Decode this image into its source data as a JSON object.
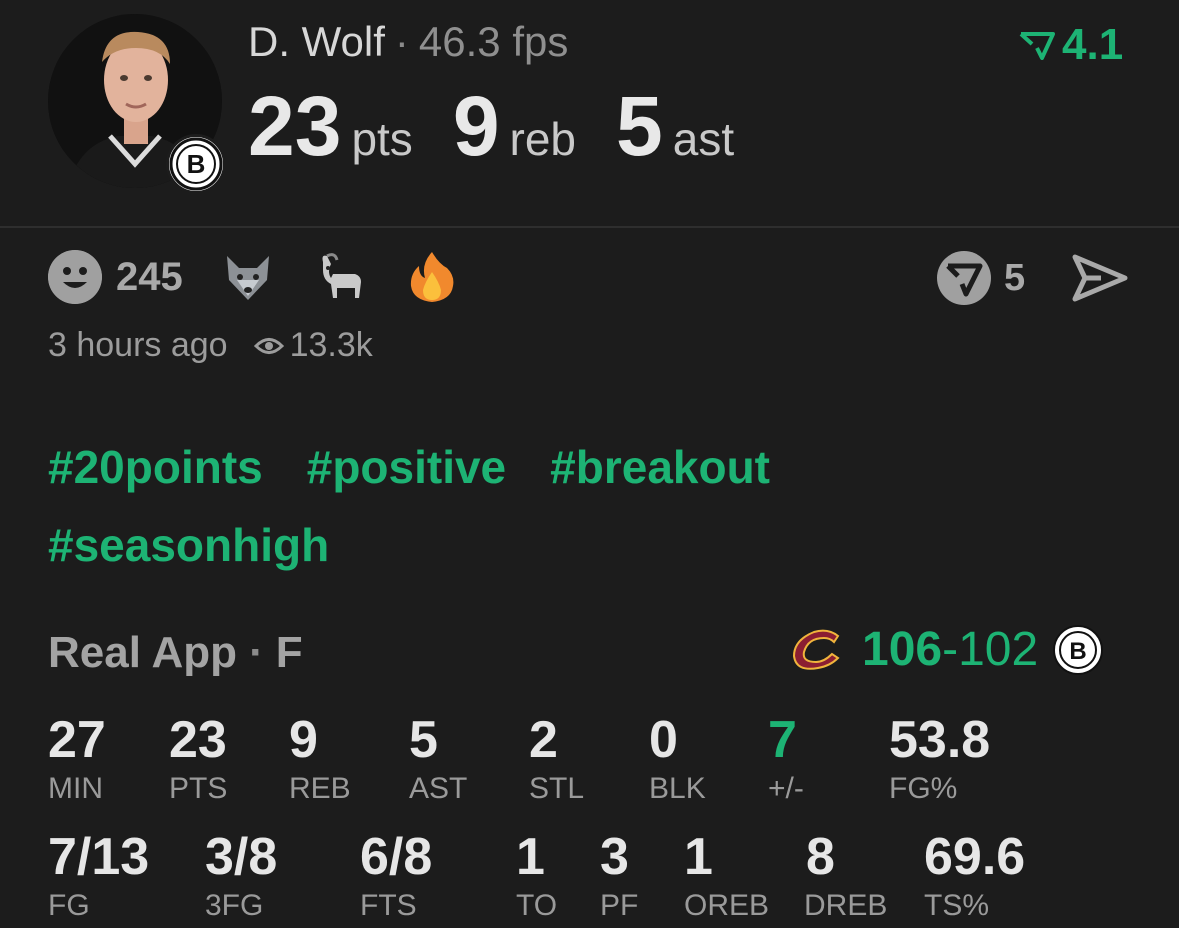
{
  "player": {
    "name": "D. Wolf",
    "fps": "46.3 fps",
    "pts_value": "23",
    "pts_unit": "pts",
    "reb_value": "9",
    "reb_unit": "reb",
    "ast_value": "5",
    "ast_unit": "ast",
    "rating": "4.1",
    "team_badge_letter": "B"
  },
  "reactions": {
    "smile_count": "245",
    "emojis": [
      "wolf-icon",
      "goat-icon",
      "fire-icon"
    ],
    "share_count": "5"
  },
  "meta": {
    "time": "3 hours ago",
    "views": "13.3k"
  },
  "tags": [
    "#20points",
    "#positive",
    "#breakout",
    "#seasonhigh"
  ],
  "game": {
    "source": "Real App",
    "status": "F",
    "score_home": "106",
    "score_away": "102",
    "away_badge_letter": "B"
  },
  "boxscore": {
    "row1": [
      {
        "value": "27",
        "label": "MIN"
      },
      {
        "value": "23",
        "label": "PTS"
      },
      {
        "value": "9",
        "label": "REB"
      },
      {
        "value": "5",
        "label": "AST"
      },
      {
        "value": "2",
        "label": "STL"
      },
      {
        "value": "0",
        "label": "BLK"
      },
      {
        "value": "7",
        "label": "+/-"
      },
      {
        "value": "53.8",
        "label": "FG%"
      }
    ],
    "row2": [
      {
        "value": "7/13",
        "label": "FG"
      },
      {
        "value": "3/8",
        "label": "3FG"
      },
      {
        "value": "6/8",
        "label": "FTS"
      },
      {
        "value": "1",
        "label": "TO"
      },
      {
        "value": "3",
        "label": "PF"
      },
      {
        "value": "1",
        "label": "OREB"
      },
      {
        "value": "8",
        "label": "DREB"
      },
      {
        "value": "69.6",
        "label": "TS%"
      }
    ]
  },
  "colors": {
    "accent": "#1db374",
    "background": "#1c1c1c"
  }
}
